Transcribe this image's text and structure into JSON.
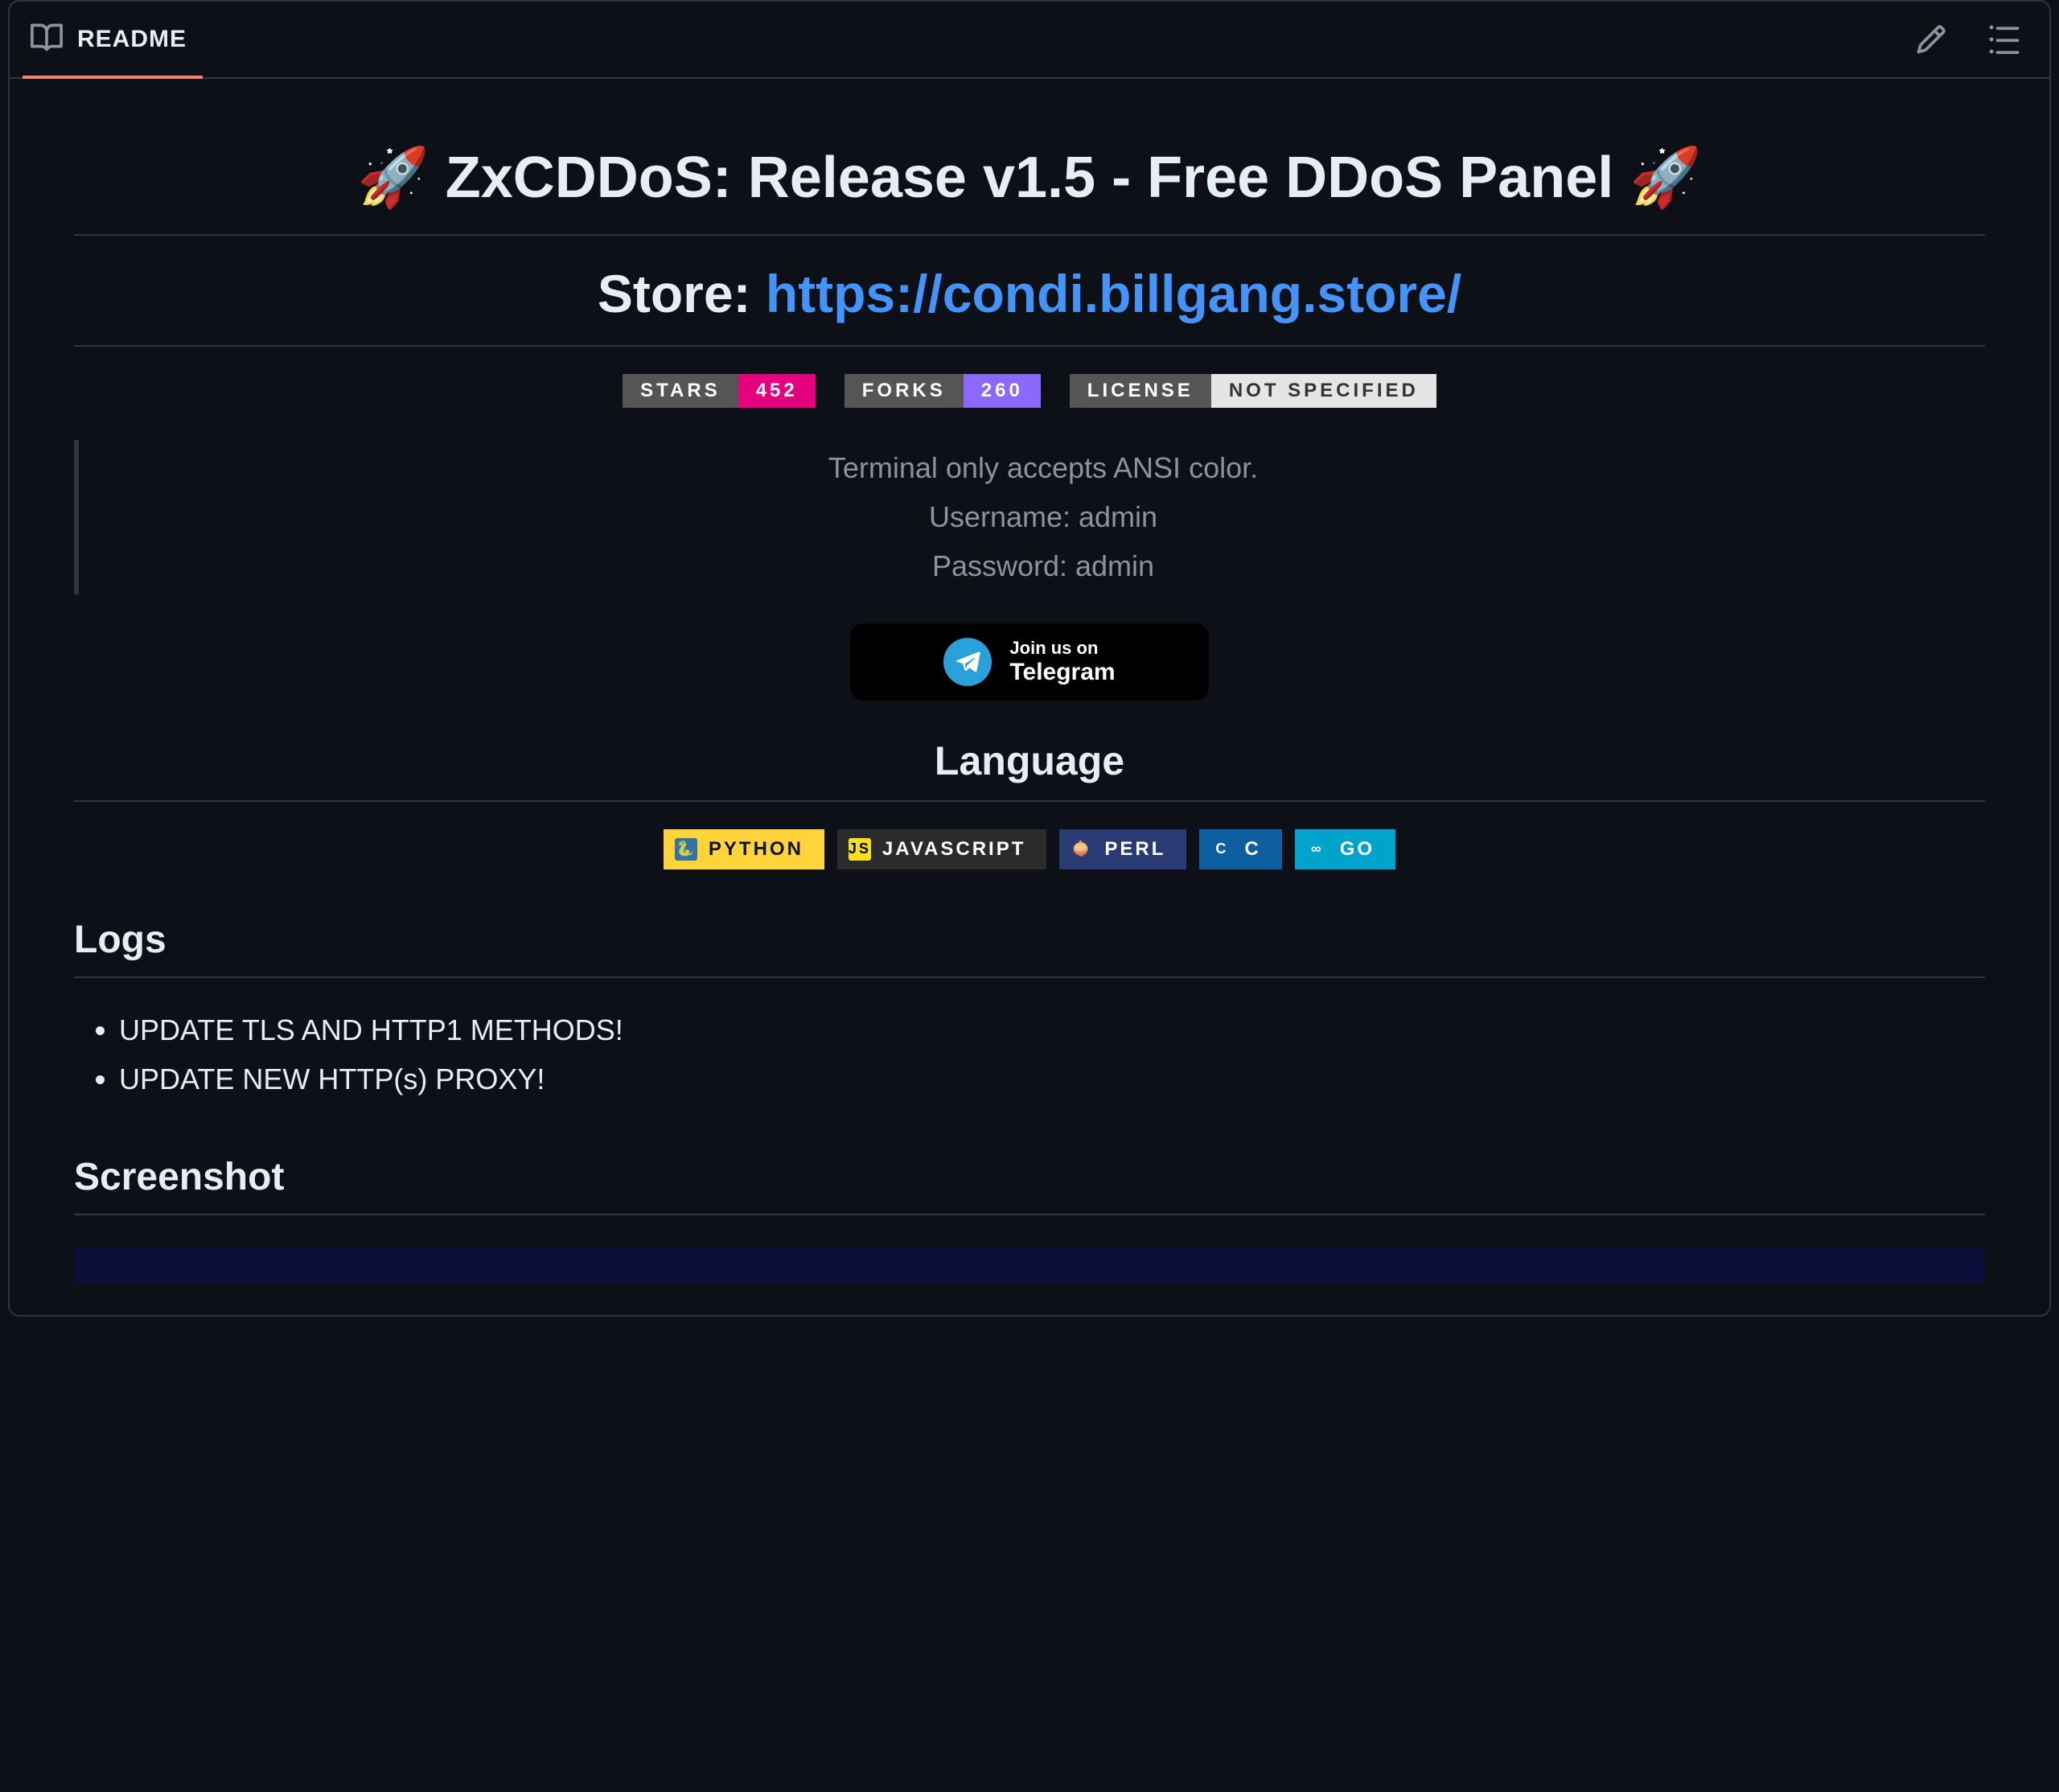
{
  "tab": {
    "label": "README"
  },
  "title": {
    "emoji": "🚀",
    "text": "ZxCDDoS: Release v1.5 - Free DDoS Panel"
  },
  "store": {
    "label": "Store:",
    "url": "https://condi.billgang.store/"
  },
  "badges": {
    "stars": {
      "label": "STARS",
      "value": "452"
    },
    "forks": {
      "label": "FORKS",
      "value": "260"
    },
    "license": {
      "label": "LICENSE",
      "value": "NOT SPECIFIED"
    }
  },
  "quote": {
    "line1": "Terminal only accepts ANSI color.",
    "line2": "Username: admin",
    "line3": "Password: admin"
  },
  "telegram": {
    "small": "Join us on",
    "big": "Telegram"
  },
  "language": {
    "heading": "Language",
    "items": [
      "PYTHON",
      "JAVASCRIPT",
      "PERL",
      "C",
      "GO"
    ]
  },
  "logs": {
    "heading": "Logs",
    "items": [
      "UPDATE TLS AND HTTP1 METHODS!",
      "UPDATE NEW HTTP(s) PROXY!"
    ]
  },
  "screenshot": {
    "heading": "Screenshot"
  }
}
